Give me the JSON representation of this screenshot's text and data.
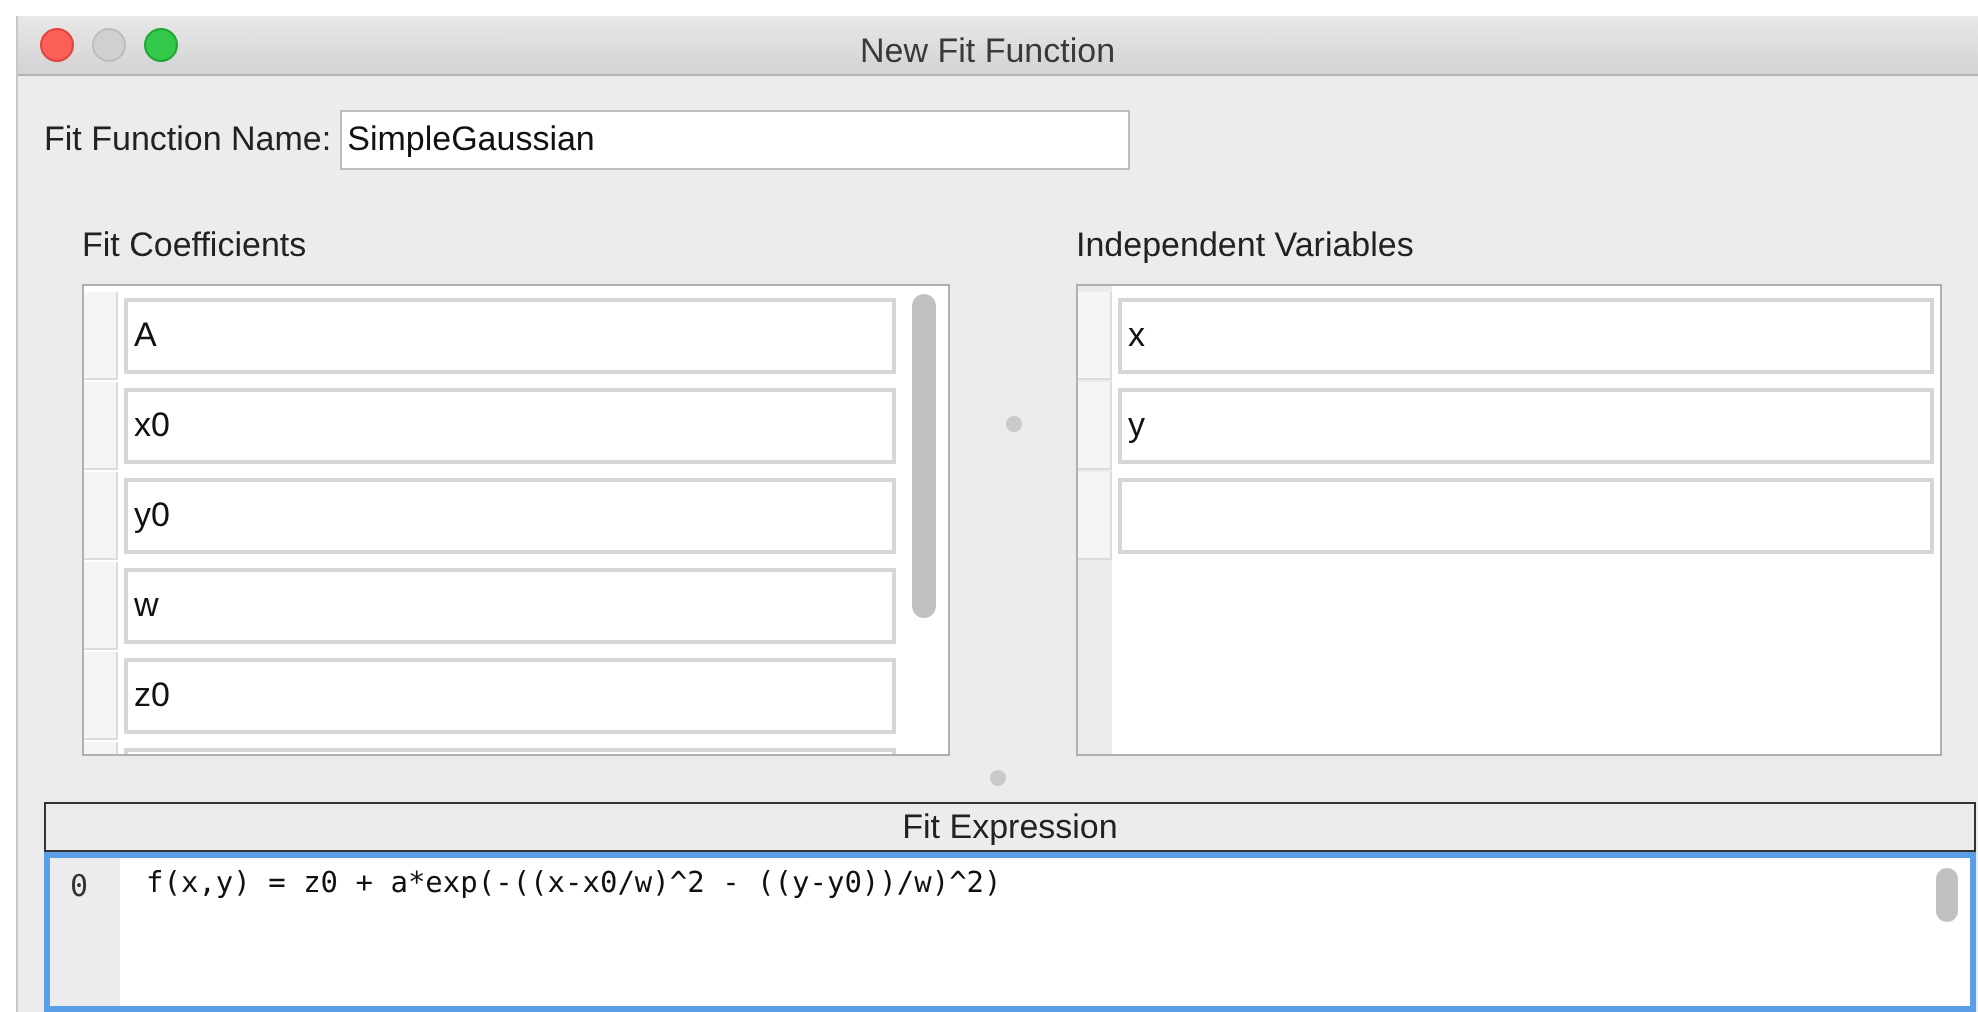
{
  "window": {
    "title": "New Fit Function"
  },
  "name_field": {
    "label": "Fit Function Name:",
    "value": "SimpleGaussian"
  },
  "fit_coefficients": {
    "title": "Fit Coefficients",
    "rows": [
      {
        "value": "A"
      },
      {
        "value": "x0"
      },
      {
        "value": "y0"
      },
      {
        "value": "w"
      },
      {
        "value": "z0"
      },
      {}
    ]
  },
  "independent_variables": {
    "title": "Independent Variables",
    "rows": [
      {
        "value": "x"
      },
      {
        "value": "y"
      },
      {}
    ]
  },
  "fit_expression": {
    "title": "Fit Expression",
    "lines": [
      {
        "number": "0",
        "code": "f(x,y) = z0 + a*exp(-((x-x0/w)^2 - ((y-y0))/w)^2)"
      }
    ]
  }
}
